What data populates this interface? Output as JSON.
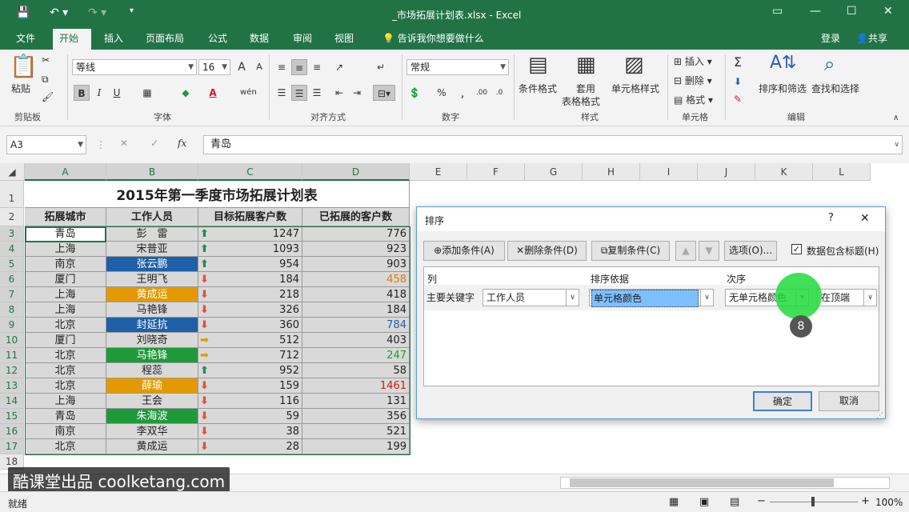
{
  "window": {
    "title": "_市场拓展计划表.xlsx - Excel"
  },
  "tabs": [
    "文件",
    "开始",
    "插入",
    "页面布局",
    "公式",
    "数据",
    "审阅",
    "视图"
  ],
  "tell_me": "告诉我你想要做什么",
  "user": {
    "login": "登录",
    "share": "共享"
  },
  "ribbon": {
    "paste": "粘贴",
    "font_name": "等线",
    "font_size": "16",
    "number_format": "常规",
    "bold": "B",
    "italic": "I",
    "underline": "U",
    "currency": "%",
    "cond_format": "条件格式",
    "table_format_1": "套用",
    "table_format_2": "表格格式",
    "cell_style": "单元格样式",
    "insert": "插入",
    "delete": "删除",
    "format": "格式",
    "sort_filter": "排序和筛选",
    "find_select": "查找和选择",
    "groups": {
      "clipboard": "剪贴板",
      "font": "字体",
      "align": "对齐方式",
      "number": "数字",
      "styles": "样式",
      "cells": "单元格",
      "edit": "编辑"
    }
  },
  "formula_bar": {
    "name_box": "A3",
    "value": "青岛",
    "fx": "fx"
  },
  "columns": [
    "A",
    "B",
    "C",
    "D",
    "E",
    "F",
    "G",
    "H",
    "I",
    "J",
    "K",
    "L"
  ],
  "rows": [
    "1",
    "2",
    "3",
    "4",
    "5",
    "6",
    "7",
    "8",
    "9",
    "10",
    "11",
    "12",
    "13",
    "14",
    "15",
    "16",
    "17",
    "18"
  ],
  "sheet": {
    "title": "2015年第一季度市场拓展计划表",
    "headers": [
      "拓展城市",
      "工作人员",
      "目标拓展客户数",
      "已拓展的客户数"
    ],
    "data": [
      {
        "city": "青岛",
        "person": "彭　雷",
        "target": "1247",
        "done": "776",
        "trend": "up",
        "pfill": "",
        "dcolor": ""
      },
      {
        "city": "上海",
        "person": "宋普亚",
        "target": "1093",
        "done": "923",
        "trend": "up",
        "pfill": "",
        "dcolor": ""
      },
      {
        "city": "南京",
        "person": "张云鹏",
        "target": "954",
        "done": "903",
        "trend": "up",
        "pfill": "#1f5fa8",
        "dcolor": ""
      },
      {
        "city": "厦门",
        "person": "王明飞",
        "target": "184",
        "done": "458",
        "trend": "down",
        "pfill": "",
        "dcolor": "#e07a00"
      },
      {
        "city": "上海",
        "person": "黄成运",
        "target": "218",
        "done": "418",
        "trend": "down",
        "pfill": "#e39a00",
        "dcolor": ""
      },
      {
        "city": "上海",
        "person": "马艳锋",
        "target": "326",
        "done": "184",
        "trend": "down",
        "pfill": "",
        "dcolor": ""
      },
      {
        "city": "北京",
        "person": "封延抗",
        "target": "360",
        "done": "784",
        "trend": "down",
        "pfill": "#1f5fa8",
        "dcolor": "#1f5fa8"
      },
      {
        "city": "厦门",
        "person": "刘晓奇",
        "target": "512",
        "done": "403",
        "trend": "side",
        "pfill": "",
        "dcolor": ""
      },
      {
        "city": "北京",
        "person": "马艳锋",
        "target": "712",
        "done": "247",
        "trend": "side",
        "pfill": "#1e9a3a",
        "dcolor": "#1e9a3a"
      },
      {
        "city": "北京",
        "person": "程蕊",
        "target": "952",
        "done": "58",
        "trend": "up",
        "pfill": "",
        "dcolor": ""
      },
      {
        "city": "北京",
        "person": "薛瑜",
        "target": "159",
        "done": "1461",
        "trend": "down",
        "pfill": "#e39a00",
        "dcolor": "#d21a1a"
      },
      {
        "city": "上海",
        "person": "王会",
        "target": "116",
        "done": "131",
        "trend": "down",
        "pfill": "",
        "dcolor": ""
      },
      {
        "city": "青岛",
        "person": "朱海波",
        "target": "59",
        "done": "356",
        "trend": "down",
        "pfill": "#1e9a3a",
        "dcolor": ""
      },
      {
        "city": "南京",
        "person": "李双华",
        "target": "38",
        "done": "521",
        "trend": "down",
        "pfill": "",
        "dcolor": ""
      },
      {
        "city": "北京",
        "person": "黄成运",
        "target": "28",
        "done": "199",
        "trend": "down",
        "pfill": "",
        "dcolor": ""
      }
    ]
  },
  "dialog": {
    "title": "排序",
    "help": "?",
    "close": "✕",
    "add": "添加条件(A)",
    "delete": "删除条件(D)",
    "copy": "复制条件(C)",
    "options": "选项(O)...",
    "has_header": "数据包含标题(H)",
    "col_header": "列",
    "sort_on_header": "排序依据",
    "order_header": "次序",
    "row_label": "主要关键字",
    "column_value": "工作人员",
    "sort_on_value": "单元格颜色",
    "order_value": "无单元格颜色",
    "position_value": "在顶端",
    "ok": "确定",
    "cancel": "取消",
    "step": "8"
  },
  "watermark": "酷课堂出品 coolketang.com",
  "status": {
    "ready": "就绪",
    "zoom": "100%"
  }
}
